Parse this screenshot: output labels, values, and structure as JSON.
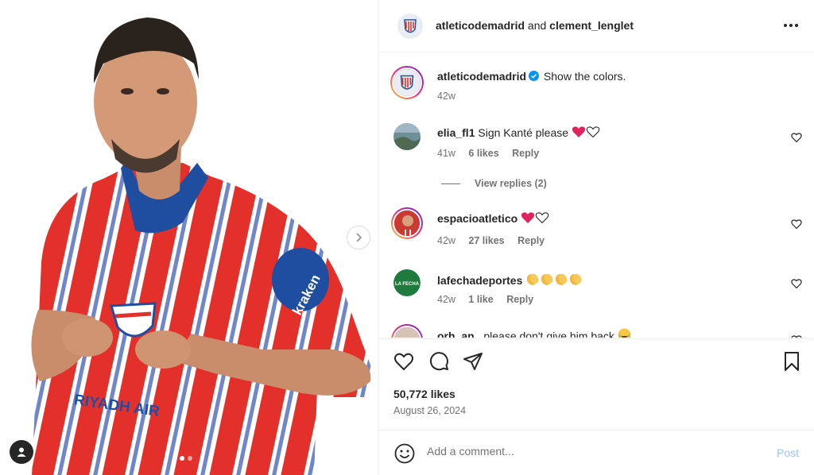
{
  "post": {
    "header": {
      "author": "atleticodemadrid",
      "connector": "and",
      "collaborator": "clement_lenglet",
      "more_icon": "more-horizontal-icon"
    },
    "caption": {
      "username": "atleticodemadrid",
      "verified": true,
      "text": "Show the colors.",
      "time": "42w"
    },
    "comments": [
      {
        "username": "elia_fl1",
        "text": "Sign Kanté please",
        "emojis": [
          "red-heart",
          "white-heart"
        ],
        "time": "41w",
        "likes": "6 likes",
        "reply": "Reply"
      },
      {
        "username": "espacioatletico",
        "text": "",
        "emojis": [
          "red-heart",
          "white-heart"
        ],
        "time": "42w",
        "likes": "27 likes",
        "reply": "Reply"
      },
      {
        "username": "lafechadeportes",
        "text": "",
        "emojis": [
          "clapping-hands",
          "clapping-hands",
          "clapping-hands",
          "clapping-hands"
        ],
        "time": "42w",
        "likes": "1 like",
        "reply": "Reply"
      },
      {
        "username": "orh_an_",
        "text": "please don't give him back",
        "emojis": [
          "tears-of-joy"
        ],
        "time": "",
        "likes": "",
        "reply": ""
      }
    ],
    "view_replies": "View replies (2)",
    "likes": "50,772 likes",
    "date": "August 26, 2024",
    "add_comment": {
      "placeholder": "Add a comment...",
      "post_label": "Post"
    },
    "carousel": {
      "slides": 2,
      "active": 1
    },
    "photo": {
      "description_icons": [
        "tag-people-icon",
        "next-slide-icon"
      ],
      "jersey_sponsors": [
        "RIYADH AIR",
        "kraken"
      ]
    },
    "colors": {
      "jersey_red": "#e4302b",
      "jersey_blue": "#1f4ea1",
      "link_blue": "#0095f6",
      "post_disabled": "#9ec4f7",
      "text": "#262626",
      "secondary": "#737373"
    }
  }
}
